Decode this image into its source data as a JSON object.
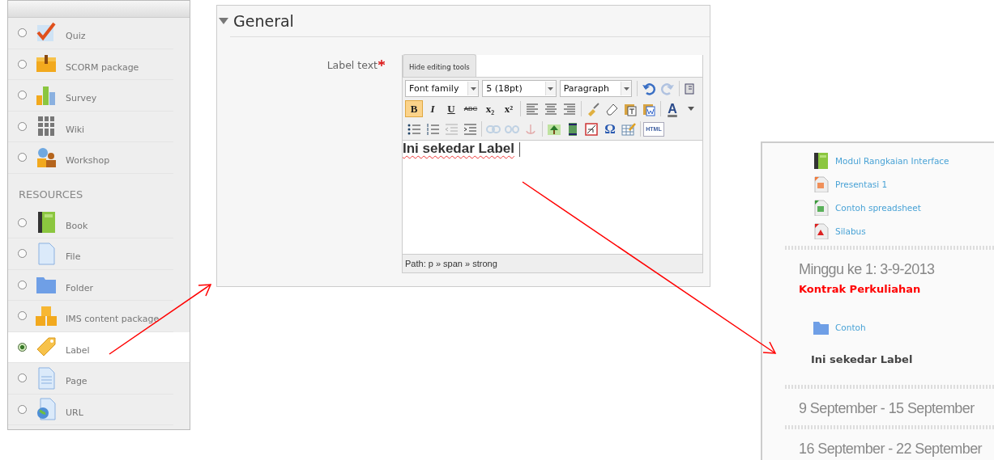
{
  "activity_chooser": {
    "items": [
      {
        "kind": "item",
        "label": "Quiz",
        "selected": false
      },
      {
        "kind": "item",
        "label": "SCORM package",
        "selected": false
      },
      {
        "kind": "item",
        "label": "Survey",
        "selected": false
      },
      {
        "kind": "item",
        "label": "Wiki",
        "selected": false
      },
      {
        "kind": "item",
        "label": "Workshop",
        "selected": false
      },
      {
        "kind": "heading",
        "label": "RESOURCES"
      },
      {
        "kind": "item",
        "label": "Book",
        "selected": false
      },
      {
        "kind": "item",
        "label": "File",
        "selected": false
      },
      {
        "kind": "item",
        "label": "Folder",
        "selected": false
      },
      {
        "kind": "item",
        "label": "IMS content package",
        "selected": false
      },
      {
        "kind": "item",
        "label": "Label",
        "selected": true
      },
      {
        "kind": "item",
        "label": "Page",
        "selected": false
      },
      {
        "kind": "item",
        "label": "URL",
        "selected": false
      }
    ]
  },
  "editor_form": {
    "section_title": "General",
    "expanded": true,
    "field_label": "Label text",
    "required": true,
    "tab": "Hide editing tools",
    "toolbar": [
      [
        {
          "kind": "select",
          "label": "Font family"
        },
        {
          "kind": "select",
          "label": "5 (18pt)"
        },
        {
          "kind": "select",
          "label": "Paragraph"
        },
        {
          "kind": "sep"
        },
        {
          "kind": "icon",
          "disabled": false
        },
        {
          "kind": "icon",
          "disabled": true
        },
        {
          "kind": "sep"
        },
        {
          "kind": "icon",
          "disabled": false
        }
      ],
      [
        {
          "kind": "glyph",
          "label": "B",
          "selected": true
        },
        {
          "kind": "glyph",
          "label": "I",
          "selected": false
        },
        {
          "kind": "glyph",
          "label": "U",
          "selected": false
        },
        {
          "kind": "glyph",
          "label": "ABC",
          "selected": false
        },
        {
          "kind": "glyph",
          "label": "x₂",
          "selected": false
        },
        {
          "kind": "glyph",
          "label": "x²",
          "selected": false
        },
        {
          "kind": "sep"
        },
        {
          "kind": "icon",
          "disabled": false
        },
        {
          "kind": "icon",
          "disabled": false
        },
        {
          "kind": "icon",
          "disabled": false
        },
        {
          "kind": "sep"
        },
        {
          "kind": "icon",
          "disabled": false
        },
        {
          "kind": "icon",
          "disabled": false
        },
        {
          "kind": "icon",
          "disabled": false
        },
        {
          "kind": "icon",
          "disabled": false
        },
        {
          "kind": "sep"
        },
        {
          "kind": "glyph",
          "label": "A",
          "selected": false
        },
        {
          "kind": "icon",
          "disabled": false
        }
      ],
      [
        {
          "kind": "icon",
          "disabled": false
        },
        {
          "kind": "icon",
          "disabled": false
        },
        {
          "kind": "icon",
          "disabled": true
        },
        {
          "kind": "icon",
          "disabled": false
        },
        {
          "kind": "sep"
        },
        {
          "kind": "icon",
          "disabled": true
        },
        {
          "kind": "icon",
          "disabled": true
        },
        {
          "kind": "icon",
          "disabled": true
        },
        {
          "kind": "sep"
        },
        {
          "kind": "icon",
          "disabled": false
        },
        {
          "kind": "icon",
          "disabled": false
        },
        {
          "kind": "icon",
          "disabled": false
        },
        {
          "kind": "glyph",
          "label": "Ω",
          "selected": false
        },
        {
          "kind": "icon",
          "disabled": false
        },
        {
          "kind": "sep"
        },
        {
          "kind": "glyph",
          "label": "HTML",
          "selected": false
        }
      ]
    ],
    "content": "Ini sekedar Label",
    "path": "Path: p » span » strong"
  },
  "course_page": {
    "items": [
      {
        "kind": "resource",
        "label": "Modul Rangkaian Interface"
      },
      {
        "kind": "resource",
        "label": "Presentasi 1"
      },
      {
        "kind": "resource",
        "label": "Contoh spreadsheet"
      },
      {
        "kind": "resource",
        "label": "Silabus"
      },
      {
        "kind": "divider"
      },
      {
        "kind": "section",
        "label": "Minggu ke 1: 3-9-2013"
      },
      {
        "kind": "summary",
        "label": "Kontrak Perkuliahan"
      },
      {
        "kind": "resource",
        "label": "Contoh"
      },
      {
        "kind": "label",
        "label": "Ini sekedar Label"
      },
      {
        "kind": "divider"
      },
      {
        "kind": "section",
        "label": "9 September - 15 September"
      },
      {
        "kind": "divider"
      },
      {
        "kind": "section",
        "label": "16 September - 22 September"
      }
    ]
  }
}
